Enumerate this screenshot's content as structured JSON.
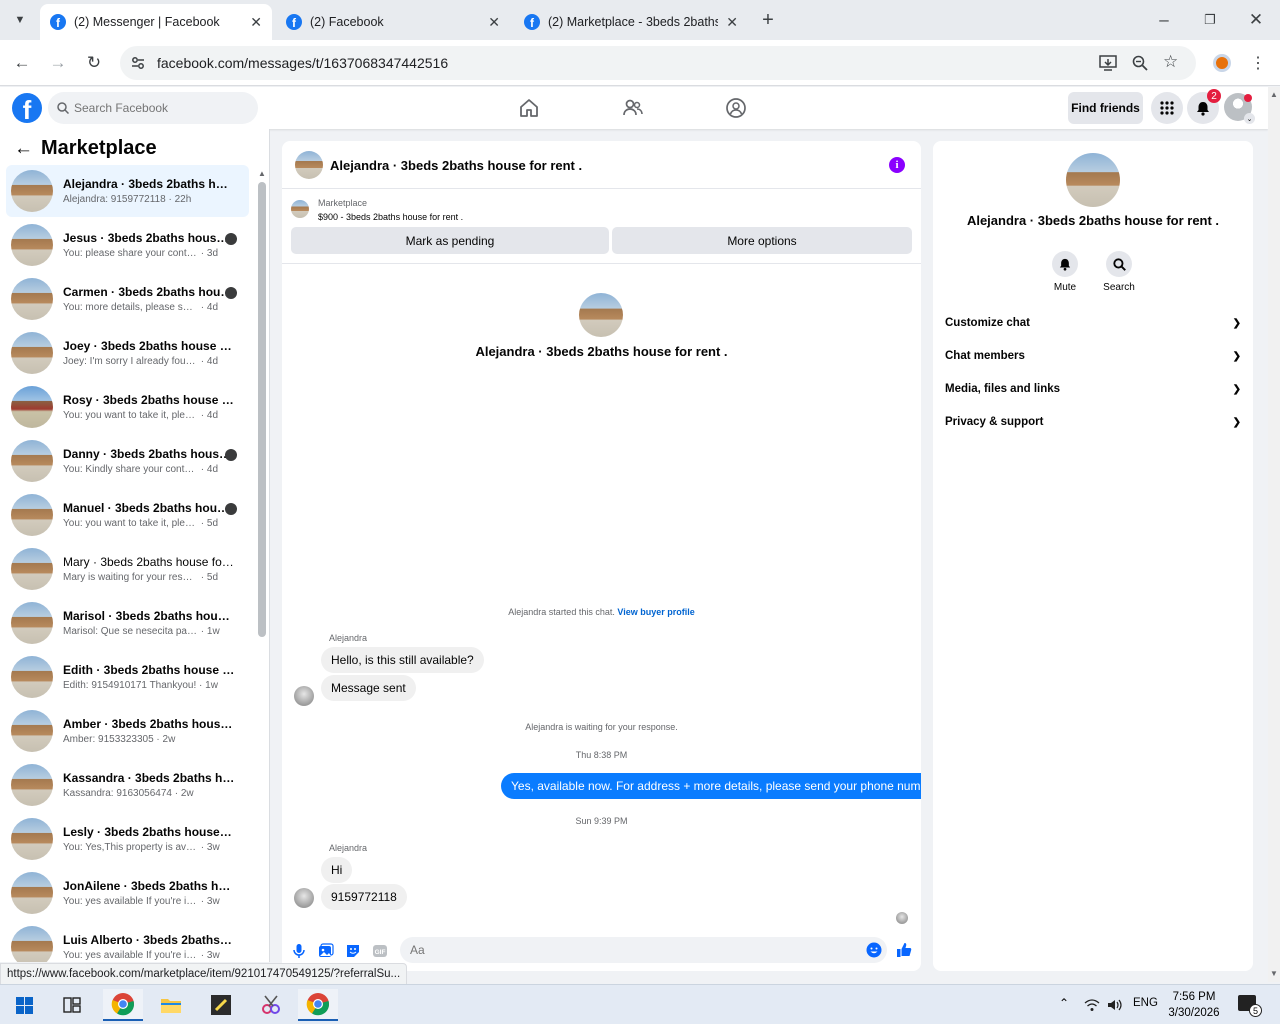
{
  "browser": {
    "tabs": [
      {
        "title": "(2) Messenger | Facebook",
        "active": true
      },
      {
        "title": "(2) Facebook",
        "active": false
      },
      {
        "title": "(2) Marketplace - 3beds 2baths",
        "active": false
      }
    ],
    "url": "facebook.com/messages/t/1637068347442516",
    "status_url": "https://www.facebook.com/marketplace/item/921017470549125/?referralSu..."
  },
  "header": {
    "search_placeholder": "Search Facebook",
    "find_friends": "Find friends",
    "notification_count": "2"
  },
  "sidebar": {
    "title": "Marketplace",
    "conversations": [
      {
        "name": "Alejandra · 3beds 2baths house...",
        "preview": "Alejandra: 9159772118",
        "time": "· 22h",
        "selected": true
      },
      {
        "name": "Jesus · 3beds 2baths house f...",
        "preview": "You: please share your contact ...",
        "time": "· 3d"
      },
      {
        "name": "Carmen · 3beds 2baths hous...",
        "preview": "You: more details, please send ...",
        "time": "· 4d"
      },
      {
        "name": "Joey · 3beds 2baths house for r...",
        "preview": "Joey: I'm sorry I already found a pl...",
        "time": "· 4d"
      },
      {
        "name": "Rosy · 3beds 2baths house for r...",
        "preview": "You: you want to take it, please se...",
        "time": "· 4d"
      },
      {
        "name": "Danny · 3beds 2baths house ...",
        "preview": "You: Kindly share your contact ...",
        "time": "· 4d"
      },
      {
        "name": "Manuel · 3beds 2baths house...",
        "preview": "You: you want to take it, please ...",
        "time": "· 5d"
      },
      {
        "name": "Mary · 3beds 2baths house for ...",
        "preview": "Mary is waiting for your response.",
        "time": "· 5d"
      },
      {
        "name": "Marisol · 3beds 2baths house f...",
        "preview": "Marisol: Que se nesecita para rent...",
        "time": "· 1w"
      },
      {
        "name": "Edith · 3beds 2baths house for r...",
        "preview": "Edith: 9154910171 Thankyou!",
        "time": "· 1w"
      },
      {
        "name": "Amber · 3beds 2baths house fo...",
        "preview": "Amber: 9153323305",
        "time": "· 2w"
      },
      {
        "name": "Kassandra · 3beds 2baths hous...",
        "preview": "Kassandra: 9163056474",
        "time": "· 2w"
      },
      {
        "name": "Lesly · 3beds 2baths house for r...",
        "preview": "You: Yes,This property is available ...",
        "time": "· 3w"
      },
      {
        "name": "JonAilene · 3beds 2baths house...",
        "preview": "You: yes available If you're interest...",
        "time": "· 3w"
      },
      {
        "name": "Luis Alberto · 3beds 2baths hou...",
        "preview": "You: yes available If you're interest...",
        "time": "· 3w"
      }
    ]
  },
  "chat": {
    "title": "Alejandra · 3beds 2baths house for rent .",
    "listing_source": "Marketplace",
    "listing_title": "$900 - 3beds 2baths house for rent .",
    "mark_pending": "Mark as pending",
    "more_options": "More options",
    "intro_name": "Alejandra · 3beds 2baths house for rent .",
    "started_text": "Alejandra started this chat.",
    "view_buyer": "View buyer profile",
    "sender1": "Alejandra",
    "msg1": "Hello, is this still available?",
    "msg2": "Message sent",
    "waiting": "Alejandra is waiting for your response.",
    "time1": "Thu 8:38 PM",
    "msg_me": "Yes, available now. For address + more details, please send your phone number.",
    "time2": "Sun 9:39 PM",
    "sender2": "Alejandra",
    "msg3": "Hi",
    "msg4": "9159772118",
    "input_placeholder": "Aa"
  },
  "right": {
    "name": "Alejandra · 3beds 2baths house for rent .",
    "mute": "Mute",
    "search": "Search",
    "rows": [
      "Customize chat",
      "Chat members",
      "Media, files and links",
      "Privacy & support"
    ]
  },
  "taskbar": {
    "lang": "ENG",
    "time": "7:56 PM",
    "date": "3/30/2026",
    "notif_count": "5"
  },
  "colors": {
    "fb_blue": "#1877f2",
    "my_bubble": "#0a7cff",
    "info_purple": "#8a00ff",
    "selected_row": "#ebf5ff"
  }
}
